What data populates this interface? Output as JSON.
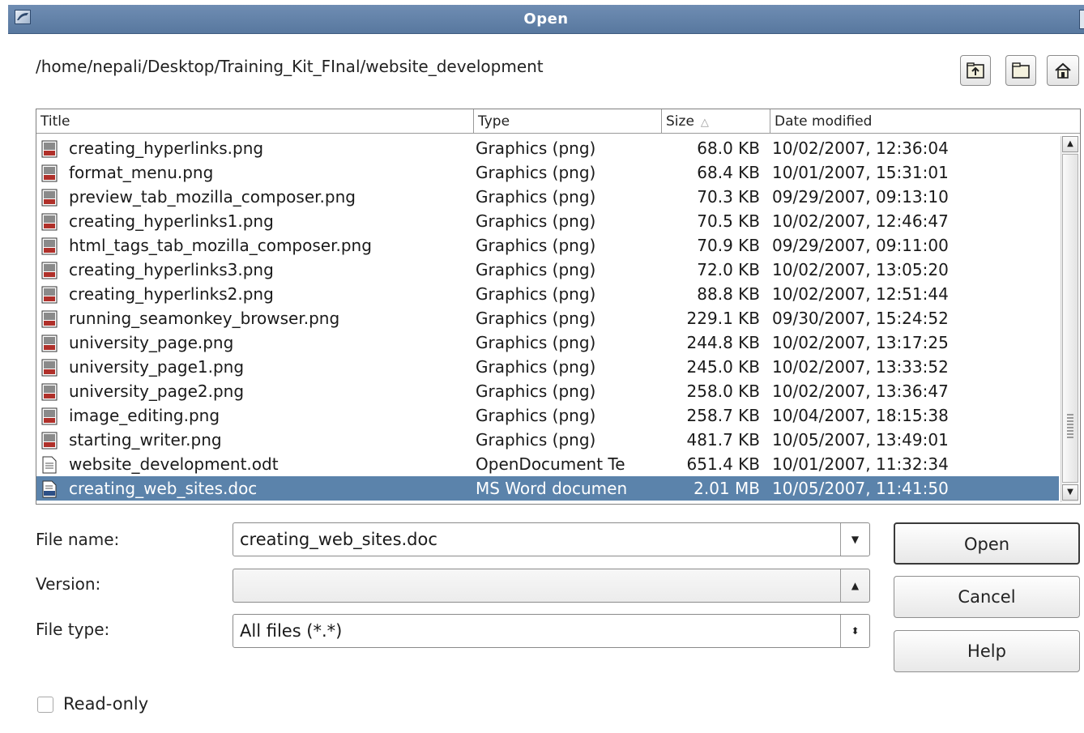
{
  "window": {
    "title": "Open"
  },
  "path": "/home/nepali/Desktop/Training_Kit_FInal/website_development",
  "toolbar": [
    {
      "name": "up-one-level-button",
      "icon": "folder-up-icon"
    },
    {
      "name": "new-folder-button",
      "icon": "new-folder-icon"
    },
    {
      "name": "default-directory-button",
      "icon": "home-icon"
    }
  ],
  "columns": {
    "title": "Title",
    "type": "Type",
    "size": "Size",
    "date": "Date modified"
  },
  "files": [
    {
      "title": "creating_hyperlinks.png",
      "type": "Graphics (png)",
      "size": "68.0 KB",
      "date": "10/02/2007, 12:36:04",
      "icon": "png"
    },
    {
      "title": "format_menu.png",
      "type": "Graphics (png)",
      "size": "68.4 KB",
      "date": "10/01/2007, 15:31:01",
      "icon": "png"
    },
    {
      "title": "preview_tab_mozilla_composer.png",
      "type": "Graphics (png)",
      "size": "70.3 KB",
      "date": "09/29/2007, 09:13:10",
      "icon": "png"
    },
    {
      "title": "creating_hyperlinks1.png",
      "type": "Graphics (png)",
      "size": "70.5 KB",
      "date": "10/02/2007, 12:46:47",
      "icon": "png"
    },
    {
      "title": "html_tags_tab_mozilla_composer.png",
      "type": "Graphics (png)",
      "size": "70.9 KB",
      "date": "09/29/2007, 09:11:00",
      "icon": "png"
    },
    {
      "title": "creating_hyperlinks3.png",
      "type": "Graphics (png)",
      "size": "72.0 KB",
      "date": "10/02/2007, 13:05:20",
      "icon": "png"
    },
    {
      "title": "creating_hyperlinks2.png",
      "type": "Graphics (png)",
      "size": "88.8 KB",
      "date": "10/02/2007, 12:51:44",
      "icon": "png"
    },
    {
      "title": "running_seamonkey_browser.png",
      "type": "Graphics (png)",
      "size": "229.1 KB",
      "date": "09/30/2007, 15:24:52",
      "icon": "png"
    },
    {
      "title": "university_page.png",
      "type": "Graphics (png)",
      "size": "244.8 KB",
      "date": "10/02/2007, 13:17:25",
      "icon": "png"
    },
    {
      "title": "university_page1.png",
      "type": "Graphics (png)",
      "size": "245.0 KB",
      "date": "10/02/2007, 13:33:52",
      "icon": "png"
    },
    {
      "title": "university_page2.png",
      "type": "Graphics (png)",
      "size": "258.0 KB",
      "date": "10/02/2007, 13:36:47",
      "icon": "png"
    },
    {
      "title": "image_editing.png",
      "type": "Graphics (png)",
      "size": "258.7 KB",
      "date": "10/04/2007, 18:15:38",
      "icon": "png"
    },
    {
      "title": "starting_writer.png",
      "type": "Graphics (png)",
      "size": "481.7 KB",
      "date": "10/05/2007, 13:49:01",
      "icon": "png"
    },
    {
      "title": "website_development.odt",
      "type": "OpenDocument Te",
      "size": "651.4 KB",
      "date": "10/01/2007, 11:32:34",
      "icon": "odt"
    },
    {
      "title": "creating_web_sites.doc",
      "type": "MS Word documen",
      "size": "2.01 MB",
      "date": "10/05/2007, 11:41:50",
      "icon": "doc",
      "selected": true
    }
  ],
  "form": {
    "file_name_label": "File name:",
    "file_name_value": "creating_web_sites.doc",
    "version_label": "Version:",
    "version_value": "",
    "file_type_label": "File type:",
    "file_type_value": "All files (*.*)"
  },
  "buttons": {
    "open": "Open",
    "cancel": "Cancel",
    "help": "Help"
  },
  "read_only_label": "Read-only",
  "colors": {
    "titlebar": "#6380a8",
    "selection": "#5b83ab"
  }
}
